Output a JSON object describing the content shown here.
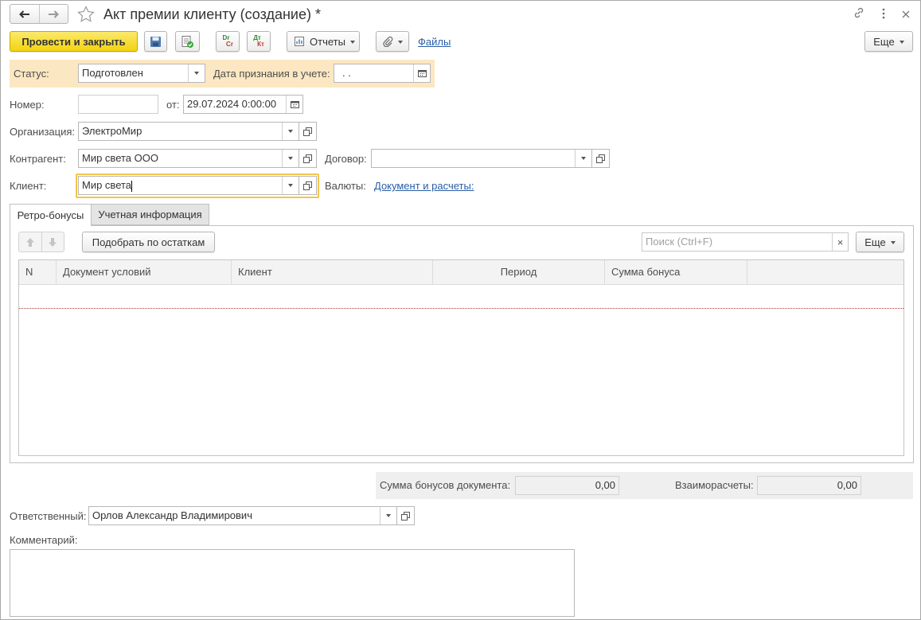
{
  "window": {
    "title": "Акт премии клиенту (создание) *"
  },
  "toolbar": {
    "post_close_label": "Провести и закрыть",
    "dr_cr_label_top": "Dr",
    "dr_cr_label_bottom": "Cr",
    "dt_kt_label_top": "Дт",
    "dt_kt_label_bottom": "Кт",
    "reports_label": "Отчеты",
    "files_label": "Файлы",
    "more_label": "Еще"
  },
  "status_row": {
    "status_label": "Статус:",
    "status_value": "Подготовлен",
    "recognition_date_label": "Дата признания в учете:",
    "recognition_date_value": " .  ."
  },
  "header": {
    "number_label": "Номер:",
    "number_value": "",
    "from_label": "от:",
    "date_value": "29.07.2024  0:00:00",
    "organization_label": "Организация:",
    "organization_value": "ЭлектроМир",
    "counterparty_label": "Контрагент:",
    "counterparty_value": "Мир света ООО",
    "contract_label": "Договор:",
    "contract_value": "",
    "client_label": "Клиент:",
    "client_value": "Мир света",
    "currencies_label": "Валюты:",
    "currencies_link": "Документ и расчеты:"
  },
  "tabs": [
    {
      "label": "Ретро-бонусы",
      "active": true
    },
    {
      "label": "Учетная информация",
      "active": false
    }
  ],
  "table_toolbar": {
    "pick_label": "Подобрать по остаткам",
    "search_placeholder": "Поиск (Ctrl+F)",
    "clear_symbol": "×",
    "more_label": "Еще"
  },
  "table": {
    "columns": [
      "N",
      "Документ условий",
      "Клиент",
      "Период",
      "Сумма бонуса"
    ],
    "rows": []
  },
  "totals": {
    "doc_bonus_sum_label": "Сумма бонусов документа:",
    "doc_bonus_sum_value": "0,00",
    "settlements_label": "Взаиморасчеты:",
    "settlements_value": "0,00"
  },
  "footer": {
    "responsible_label": "Ответственный:",
    "responsible_value": "Орлов Александр Владимирович",
    "comment_label": "Комментарий:",
    "comment_value": ""
  },
  "colors": {
    "status_bg": "#fbe7c2",
    "accent_yellow": "#f3d310",
    "active_border": "#f2c54b",
    "link": "#2a5ea5",
    "totals_bg": "#efefef"
  }
}
